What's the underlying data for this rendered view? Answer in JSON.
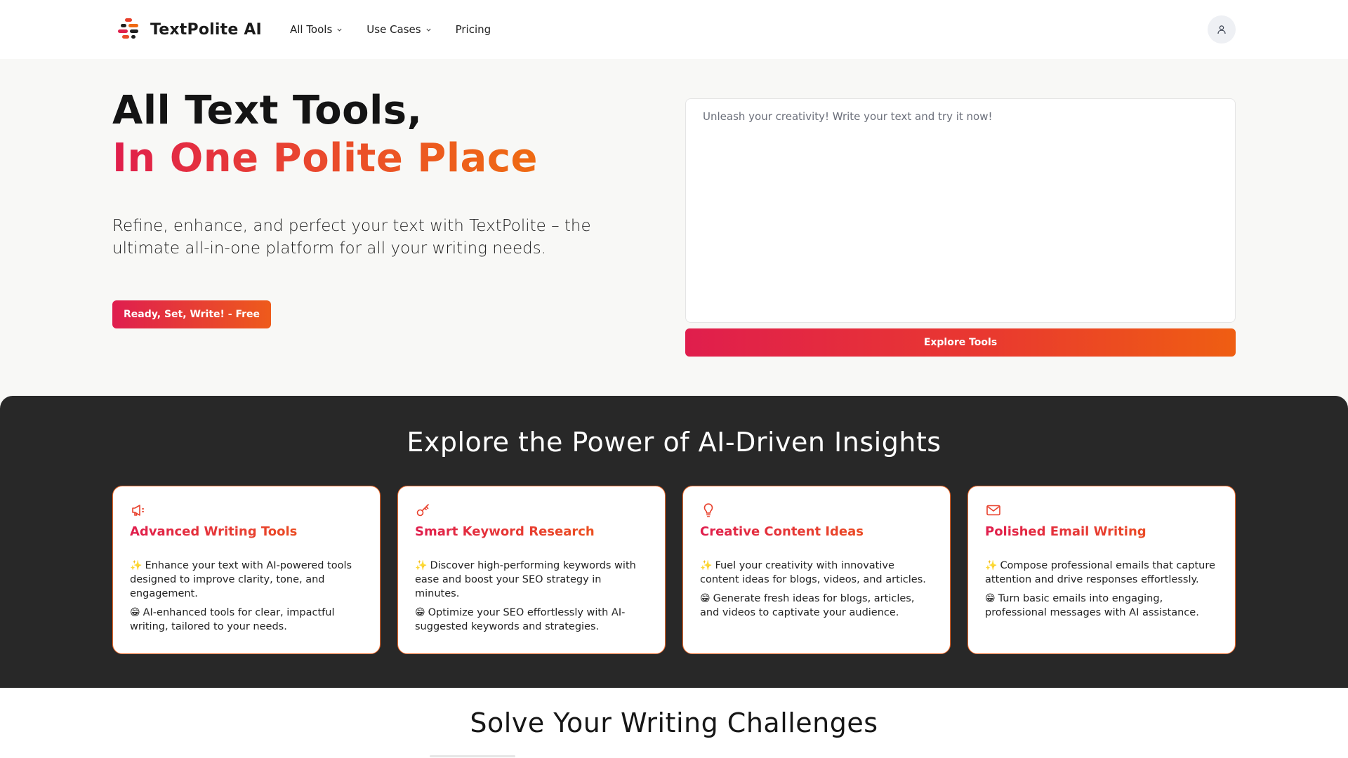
{
  "brand": {
    "name": "TextPolite AI"
  },
  "nav": {
    "items": [
      {
        "label": "All Tools",
        "has_dropdown": true
      },
      {
        "label": "Use Cases",
        "has_dropdown": true
      },
      {
        "label": "Pricing",
        "has_dropdown": false
      }
    ],
    "account_icon": "user-icon"
  },
  "hero": {
    "title_line1": "All Text Tools,",
    "title_line2": "In One Polite Place",
    "subtitle": "Refine, enhance, and perfect your text with TextPolite – the ultimate all-in-one platform for all your writing needs.",
    "cta_label": "Ready, Set, Write! - Free",
    "editor_placeholder": "Unleash your creativity! Write your text and try it now!",
    "editor_value": "",
    "explore_label": "Explore Tools"
  },
  "insights": {
    "title": "Explore the Power of AI-Driven Insights",
    "cards": [
      {
        "icon": "megaphone-icon",
        "title": "Advanced Writing Tools",
        "points": [
          {
            "emoji": "✨",
            "text": "Enhance your text with AI-powered tools designed to improve clarity, tone, and engagement."
          },
          {
            "emoji": "😁",
            "text": "AI-enhanced tools for clear, impactful writing, tailored to your needs."
          }
        ]
      },
      {
        "icon": "key-icon",
        "title": "Smart Keyword Research",
        "points": [
          {
            "emoji": "✨",
            "text": "Discover high-performing keywords with ease and boost your SEO strategy in minutes."
          },
          {
            "emoji": "😁",
            "text": "Optimize your SEO effortlessly with AI-suggested keywords and strategies."
          }
        ]
      },
      {
        "icon": "lightbulb-icon",
        "title": "Creative Content Ideas",
        "points": [
          {
            "emoji": "✨",
            "text": "Fuel your creativity with innovative content ideas for blogs, videos, and articles."
          },
          {
            "emoji": "😁",
            "text": "Generate fresh ideas for blogs, articles, and videos to captivate your audience."
          }
        ]
      },
      {
        "icon": "mail-icon",
        "title": "Polished Email Writing",
        "points": [
          {
            "emoji": "✨",
            "text": "Compose professional emails that capture attention and drive responses effortlessly."
          },
          {
            "emoji": "😁",
            "text": "Turn basic emails into engaging, professional messages with AI assistance."
          }
        ]
      }
    ]
  },
  "challenges": {
    "title": "Solve Your Writing Challenges"
  },
  "colors": {
    "gradient_start": "#e01e4d",
    "gradient_end": "#ef5e12",
    "dark_bg": "#282828",
    "page_bg": "#f8f8f6"
  }
}
